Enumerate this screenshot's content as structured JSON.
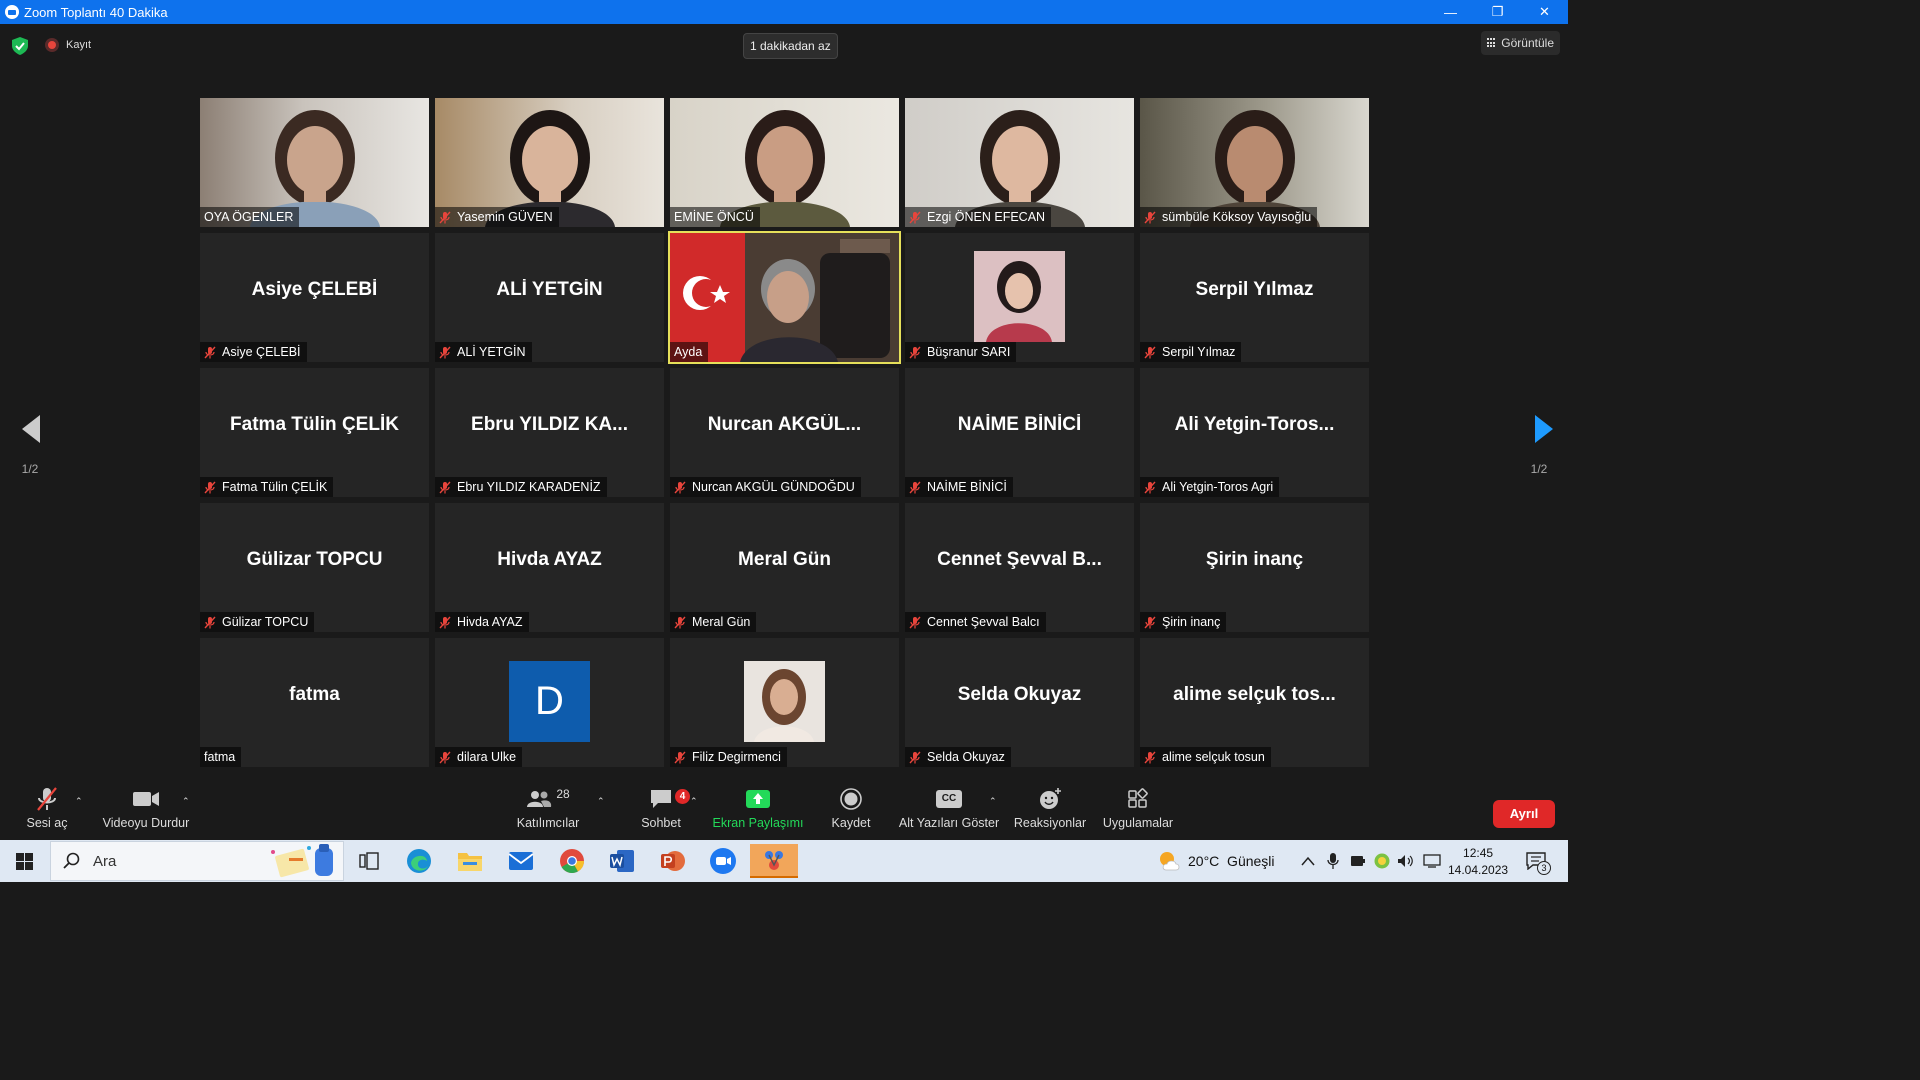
{
  "window": {
    "title": "Zoom Toplantı 40 Dakika",
    "controls": [
      "—",
      "❐",
      "✕"
    ]
  },
  "topbar": {
    "record_label": "Kayıt",
    "timer_label": "1 dakikadan az",
    "view_label": "Görüntüle"
  },
  "participants": [
    {
      "name": "OYA ÖGENLER",
      "muted": false,
      "video": true
    },
    {
      "name": "Yasemin GÜVEN",
      "muted": true,
      "video": true
    },
    {
      "name": "EMİNE ÖNCÜ",
      "muted": false,
      "video": true
    },
    {
      "name": "Ezgi ÖNEN EFECAN",
      "muted": true,
      "video": true
    },
    {
      "name": "sümbüle Köksoy Vayısoğlu",
      "muted": true,
      "video": true
    },
    {
      "name": "Asiye ÇELEBİ",
      "display": "Asiye ÇELEBİ",
      "muted": true,
      "video": false
    },
    {
      "name": "ALİ YETGİN",
      "display": "ALİ YETGİN",
      "muted": true,
      "video": false
    },
    {
      "name": "Ayda",
      "muted": false,
      "video": true,
      "active": true
    },
    {
      "name": "Büşranur SARI",
      "muted": true,
      "video": false,
      "photo": true
    },
    {
      "name": "Serpil Yılmaz",
      "display": "Serpil Yılmaz",
      "muted": true,
      "video": false
    },
    {
      "name": "Fatma Tülin ÇELİK",
      "display": "Fatma Tülin ÇELİK",
      "muted": true,
      "video": false
    },
    {
      "name": "Ebru YILDIZ KARADENİZ",
      "display": "Ebru YILDIZ KA...",
      "muted": true,
      "video": false
    },
    {
      "name": "Nurcan AKGÜL GÜNDOĞDU",
      "display": "Nurcan AKGÜL...",
      "muted": true,
      "video": false
    },
    {
      "name": "NAİME BİNİCİ",
      "display": "NAİME BİNİCİ",
      "muted": true,
      "video": false
    },
    {
      "name": "Ali Yetgin-Toros Agri",
      "display": "Ali Yetgin-Toros...",
      "muted": true,
      "video": false
    },
    {
      "name": "Gülizar TOPCU",
      "display": "Gülizar TOPCU",
      "muted": true,
      "video": false
    },
    {
      "name": "Hivda AYAZ",
      "display": "Hivda AYAZ",
      "muted": true,
      "video": false
    },
    {
      "name": "Meral Gün",
      "display": "Meral Gün",
      "muted": true,
      "video": false
    },
    {
      "name": "Cennet Şevval Balcı",
      "display": "Cennet Şevval B...",
      "muted": true,
      "video": false
    },
    {
      "name": "Şirin inanç",
      "display": "Şirin inanç",
      "muted": true,
      "video": false
    },
    {
      "name": "fatma",
      "display": "fatma",
      "muted": false,
      "video": false
    },
    {
      "name": "dilara Ulke",
      "muted": true,
      "video": false,
      "letter": "D"
    },
    {
      "name": "Filiz Degirmenci",
      "muted": true,
      "video": false,
      "photo": true
    },
    {
      "name": "Selda Okuyaz",
      "display": "Selda Okuyaz",
      "muted": true,
      "video": false
    },
    {
      "name": "alime selçuk tosun",
      "display": "alime selçuk tos...",
      "muted": true,
      "video": false
    }
  ],
  "pager": {
    "left": "1/2",
    "right": "1/2"
  },
  "toolbar": {
    "unmute": "Sesi aç",
    "stop_video": "Videoyu Durdur",
    "participants": "Katılımcılar",
    "participants_count": "28",
    "chat": "Sohbet",
    "chat_badge": "4",
    "share": "Ekran Paylaşımı",
    "record": "Kaydet",
    "captions": "Alt Yazıları Göster",
    "captions_icon_text": "CC",
    "reactions": "Reaksiyonlar",
    "apps": "Uygulamalar",
    "leave": "Ayrıl"
  },
  "taskbar": {
    "search_placeholder": "Ara",
    "weather": "20°C  Güneşli",
    "time": "12:45",
    "date": "14.04.2023",
    "notifications": "3"
  },
  "colors": {
    "title_bar": "#0e72ed",
    "active_speaker": "#e6e05a",
    "share_green": "#23d959",
    "leave_red": "#e02828",
    "mute_red": "#e8453c"
  }
}
